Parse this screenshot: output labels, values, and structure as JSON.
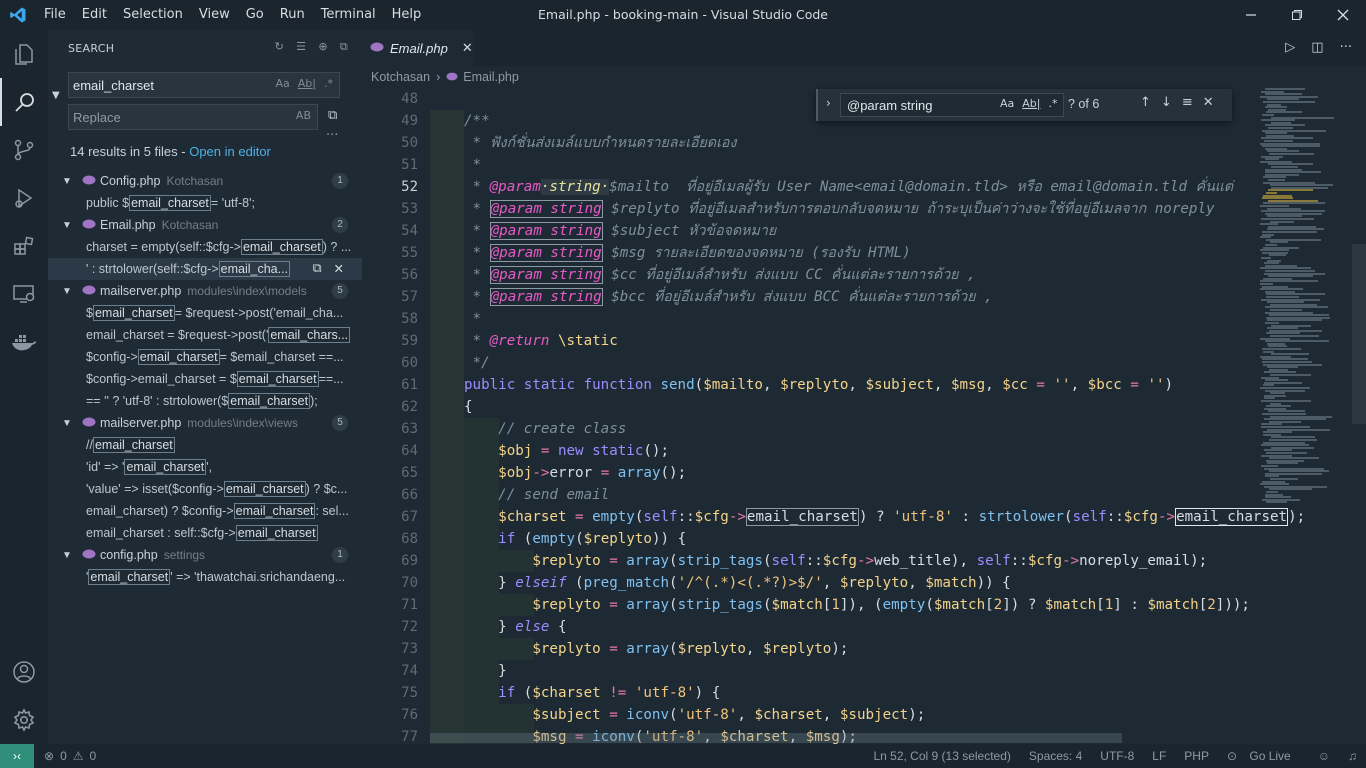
{
  "window": {
    "title": "Email.php - booking-main - Visual Studio Code",
    "menu": [
      "File",
      "Edit",
      "Selection",
      "View",
      "Go",
      "Run",
      "Terminal",
      "Help"
    ]
  },
  "sidebar": {
    "title": "SEARCH",
    "search_value": "email_charset",
    "replace_placeholder": "Replace",
    "opt_case": "Aa",
    "opt_word": "Ab|",
    "opt_regex": ".*",
    "opt_preserve": "AB",
    "summary": "14 results in 5 files - ",
    "open_in_editor": "Open in editor",
    "files": [
      {
        "name": "Config.php",
        "path": "Kotchasan",
        "count": "1",
        "matches": [
          {
            "pre": "public $",
            "hl": "email_charset",
            "post": " = 'utf-8';"
          }
        ]
      },
      {
        "name": "Email.php",
        "path": "Kotchasan",
        "count": "2",
        "matches": [
          {
            "pre": "charset = empty(self::$cfg->",
            "hl": "email_charset",
            "post": ") ? ..."
          },
          {
            "pre": "' : strtolower(self::$cfg->",
            "hl": "email_cha...",
            "post": ""
          }
        ]
      },
      {
        "name": "mailserver.php",
        "path": "modules\\index\\models",
        "count": "5",
        "matches": [
          {
            "pre": "$",
            "hl": "email_charset",
            "post": " = $request->post('email_cha..."
          },
          {
            "pre": "email_charset = $request->post('",
            "hl": "email_chars...",
            "post": ""
          },
          {
            "pre": "$config->",
            "hl": "email_charset",
            "post": " = $email_charset ==..."
          },
          {
            "pre": "$config->email_charset = $",
            "hl": "email_charset",
            "post": " ==..."
          },
          {
            "pre": "== '' ? 'utf-8' : strtolower($",
            "hl": "email_charset",
            "post": ");"
          }
        ]
      },
      {
        "name": "mailserver.php",
        "path": "modules\\index\\views",
        "count": "5",
        "matches": [
          {
            "pre": "// ",
            "hl": "email_charset",
            "post": ""
          },
          {
            "pre": "'id' => '",
            "hl": "email_charset",
            "post": "',"
          },
          {
            "pre": "'value' => isset($config->",
            "hl": "email_charset",
            "post": ") ? $c..."
          },
          {
            "pre": "email_charset) ? $config->",
            "hl": "email_charset",
            "post": " : sel..."
          },
          {
            "pre": "email_charset : self::$cfg->",
            "hl": "email_charset",
            "post": ""
          }
        ]
      },
      {
        "name": "config.php",
        "path": "settings",
        "count": "1",
        "matches": [
          {
            "pre": "'",
            "hl": "email_charset",
            "post": "' => 'thawatchai.srichandaeng..."
          }
        ]
      }
    ]
  },
  "editor": {
    "tab_label": "Email.php",
    "breadcrumb": [
      "Kotchasan",
      "Email.php"
    ],
    "find_value": "@param string",
    "find_count": "? of 6",
    "line_numbers": [
      "48",
      "49",
      "50",
      "51",
      "52",
      "53",
      "54",
      "55",
      "56",
      "57",
      "58",
      "59",
      "60",
      "61",
      "62",
      "63",
      "64",
      "65",
      "66",
      "67",
      "68",
      "69",
      "70",
      "71",
      "72",
      "73",
      "74",
      "75",
      "76",
      "77"
    ],
    "current_line": "52"
  },
  "status": {
    "errors": "0",
    "warnings": "0",
    "position": "Ln 52, Col 9 (13 selected)",
    "spaces": "Spaces: 4",
    "encoding": "UTF-8",
    "eol": "LF",
    "language": "PHP",
    "golive": "Go Live"
  },
  "colors": {
    "accent": "#4fb0e5",
    "php_icon": "#a074c4",
    "tag": "#e85ac8"
  }
}
